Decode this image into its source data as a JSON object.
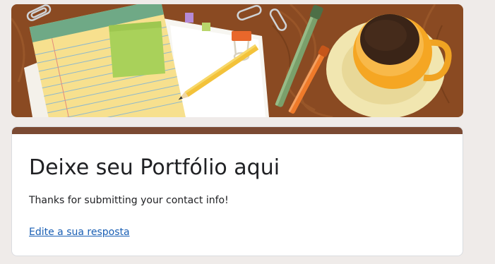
{
  "form": {
    "title": "Deixe seu Portfólio aqui",
    "confirmation_message": "Thanks for submitting your contact info!",
    "edit_link_label": "Edite a sua resposta"
  },
  "colors": {
    "background": "#efebe9",
    "accent": "#7b4a33",
    "link": "#1a5fb4",
    "text": "#202124"
  },
  "icons": [
    "header-illustration"
  ]
}
